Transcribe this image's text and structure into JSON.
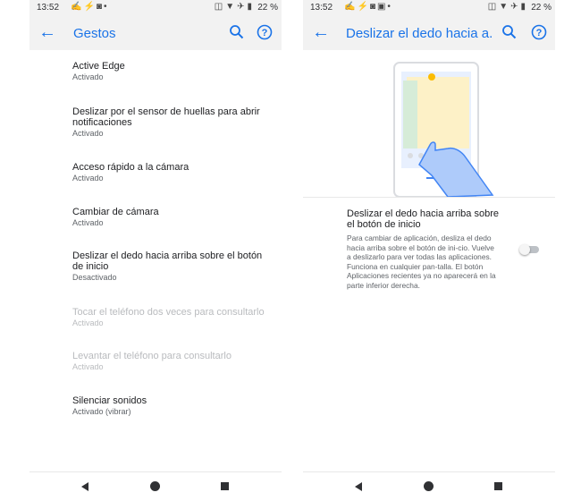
{
  "left": {
    "status": {
      "time": "13:52",
      "battery": "22 %"
    },
    "appbar": {
      "title": "Gestos"
    },
    "items": [
      {
        "title": "Active Edge",
        "subtitle": "Activado",
        "enabled": true
      },
      {
        "title": "Deslizar por el sensor de huellas para abrir notificaciones",
        "subtitle": "Activado",
        "enabled": true
      },
      {
        "title": "Acceso rápido a la cámara",
        "subtitle": "Activado",
        "enabled": true
      },
      {
        "title": "Cambiar de cámara",
        "subtitle": "Activado",
        "enabled": true
      },
      {
        "title": "Deslizar el dedo hacia arriba sobre el botón de inicio",
        "subtitle": "Desactivado",
        "enabled": true
      },
      {
        "title": "Tocar el teléfono dos veces para consultarlo",
        "subtitle": "Activado",
        "enabled": false
      },
      {
        "title": "Levantar el teléfono para consultarlo",
        "subtitle": "Activado",
        "enabled": false
      },
      {
        "title": "Silenciar sonidos",
        "subtitle": "Activado (vibrar)",
        "enabled": true
      }
    ]
  },
  "right": {
    "status": {
      "time": "13:52",
      "battery": "22 %"
    },
    "appbar": {
      "title": "Deslizar el dedo hacia a..."
    },
    "setting": {
      "title": "Deslizar el dedo hacia arriba sobre el botón de inicio",
      "description": "Para cambiar de aplicación, desliza el dedo hacia arriba sobre el botón de ini-cio. Vuelve a deslizarlo para ver todas las aplicaciones. Funciona en cualquier pan-talla. El botón Aplicaciones recientes ya no aparecerá en la parte inferior derecha.",
      "toggle_on": false
    }
  },
  "icons": {
    "status_left": [
      "gesture-icon",
      "fitness-icon",
      "instagram-icon",
      "dot-icon"
    ],
    "status_left_right_screen": [
      "gesture-icon",
      "fitness-icon",
      "instagram-icon",
      "photo-icon",
      "dot-icon"
    ],
    "status_right": [
      "vibrate-icon",
      "wifi-icon",
      "airplane-icon",
      "battery-icon"
    ],
    "appbar": [
      "back-arrow-icon",
      "search-icon",
      "help-icon"
    ],
    "navbar": [
      "nav-back-icon",
      "nav-home-icon",
      "nav-recents-icon"
    ]
  },
  "colors": {
    "accent": "#1a73e8",
    "appbar_bg": "#f2f2f2",
    "disabled_text": "#b9bbbe"
  }
}
